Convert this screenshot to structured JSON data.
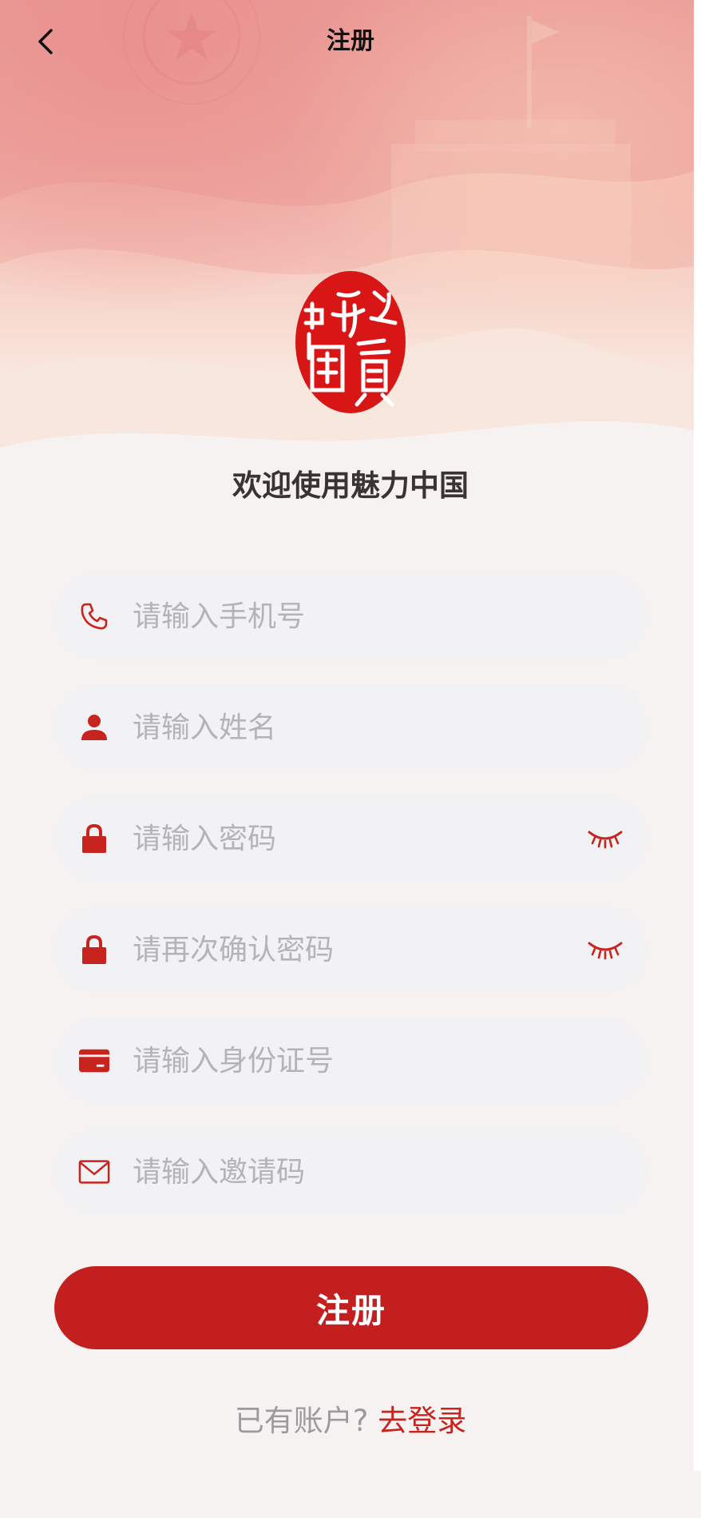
{
  "header": {
    "title": "注册"
  },
  "logo": {
    "alt": "中国梦 seal logo"
  },
  "welcome": "欢迎使用魅力中国",
  "form": {
    "phone_placeholder": "请输入手机号",
    "name_placeholder": "请输入姓名",
    "password_placeholder": "请输入密码",
    "confirm_password_placeholder": "请再次确认密码",
    "id_card_placeholder": "请输入身份证号",
    "invite_code_placeholder": "请输入邀请码"
  },
  "submit_label": "注册",
  "footer": {
    "question": "已有账户? ",
    "login_link": "去登录"
  },
  "colors": {
    "accent": "#c31f1f",
    "icon": "#c8241f",
    "field_bg": "#f2f1f3",
    "placeholder": "#b4b4b8",
    "page_bg": "#f6f2f1"
  },
  "icons": {
    "back": "chevron-left-icon",
    "phone": "phone-icon",
    "name": "user-icon",
    "password": "lock-icon",
    "confirm": "lock-icon",
    "id_card": "card-icon",
    "invite": "mail-icon",
    "visibility": "eye-closed-icon"
  }
}
